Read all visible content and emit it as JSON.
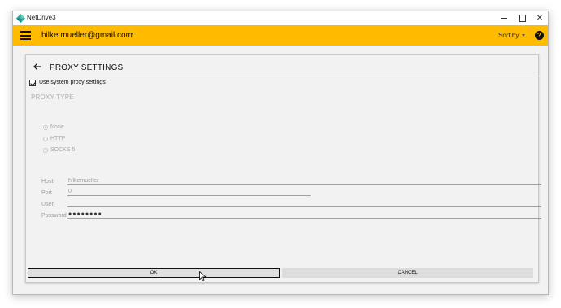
{
  "window": {
    "title": "NetDrive3",
    "close_glyph": "✕"
  },
  "appbar": {
    "account_email": "hilke.mueller@gmail.com",
    "sort_label": "Sort by",
    "help_glyph": "?",
    "accent_color": "#ffbb00"
  },
  "panel": {
    "title": "PROXY SETTINGS",
    "use_system_proxy": {
      "label": "Use system proxy settings",
      "checked": true
    },
    "proxy_type": {
      "heading": "PROXY TYPE",
      "options": [
        {
          "label": "None",
          "selected": true
        },
        {
          "label": "HTTP",
          "selected": false
        },
        {
          "label": "SOCKS 5",
          "selected": false
        }
      ]
    },
    "fields": {
      "host": {
        "label": "Host",
        "value": "hilkemueller"
      },
      "port": {
        "label": "Port",
        "value": "0"
      },
      "user": {
        "label": "User",
        "value": ""
      },
      "password": {
        "label": "Password",
        "value": "●●●●●●●●"
      }
    },
    "buttons": {
      "ok": "OK",
      "cancel": "CANCEL"
    }
  }
}
